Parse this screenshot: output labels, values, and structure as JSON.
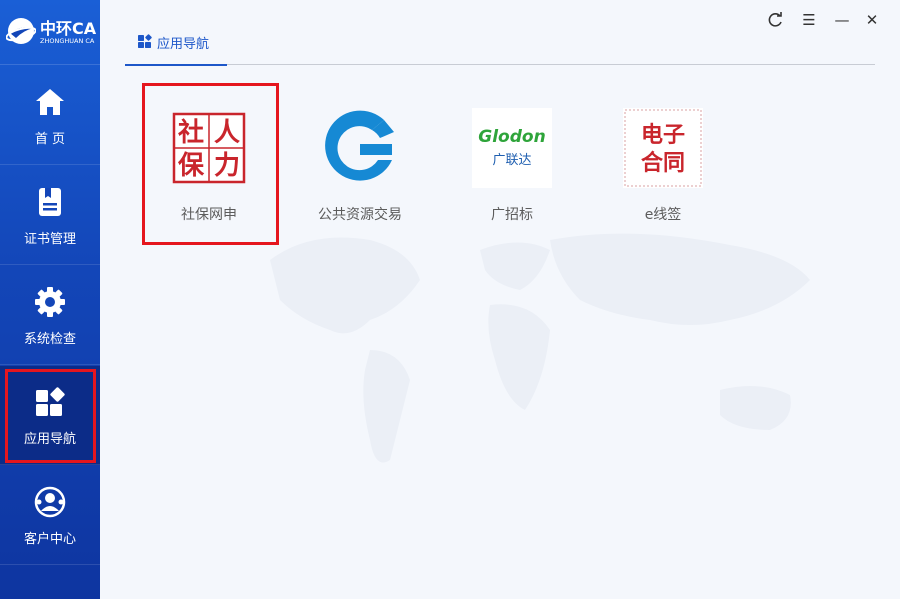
{
  "brand": {
    "name": "中环CA",
    "subtitle": "ZHONGHUAN CA"
  },
  "sidebar": {
    "items": [
      {
        "label": "首 页",
        "icon": "home-icon",
        "active": false
      },
      {
        "label": "证书管理",
        "icon": "certificate-icon",
        "active": false
      },
      {
        "label": "系统检查",
        "icon": "gear-icon",
        "active": false
      },
      {
        "label": "应用导航",
        "icon": "apps-icon",
        "active": true
      },
      {
        "label": "客户中心",
        "icon": "customer-service-icon",
        "active": false
      }
    ]
  },
  "window_controls": [
    "refresh-icon",
    "menu-icon",
    "minimize-icon",
    "close-icon"
  ],
  "tab": {
    "label": "应用导航",
    "icon": "apps-icon"
  },
  "apps": [
    {
      "name": "社保网申",
      "logo_text": [
        "社",
        "人",
        "保",
        "力"
      ],
      "selected": true
    },
    {
      "name": "公共资源交易",
      "logo_text": []
    },
    {
      "name": "广招标",
      "logo_text": [
        "Glodon",
        "广联达"
      ]
    },
    {
      "name": "e线签",
      "logo_text": [
        "电子",
        "合同"
      ]
    }
  ],
  "colors": {
    "accent": "#1d57c9",
    "highlight": "#e5161e",
    "sidebar": "#1346b8"
  }
}
